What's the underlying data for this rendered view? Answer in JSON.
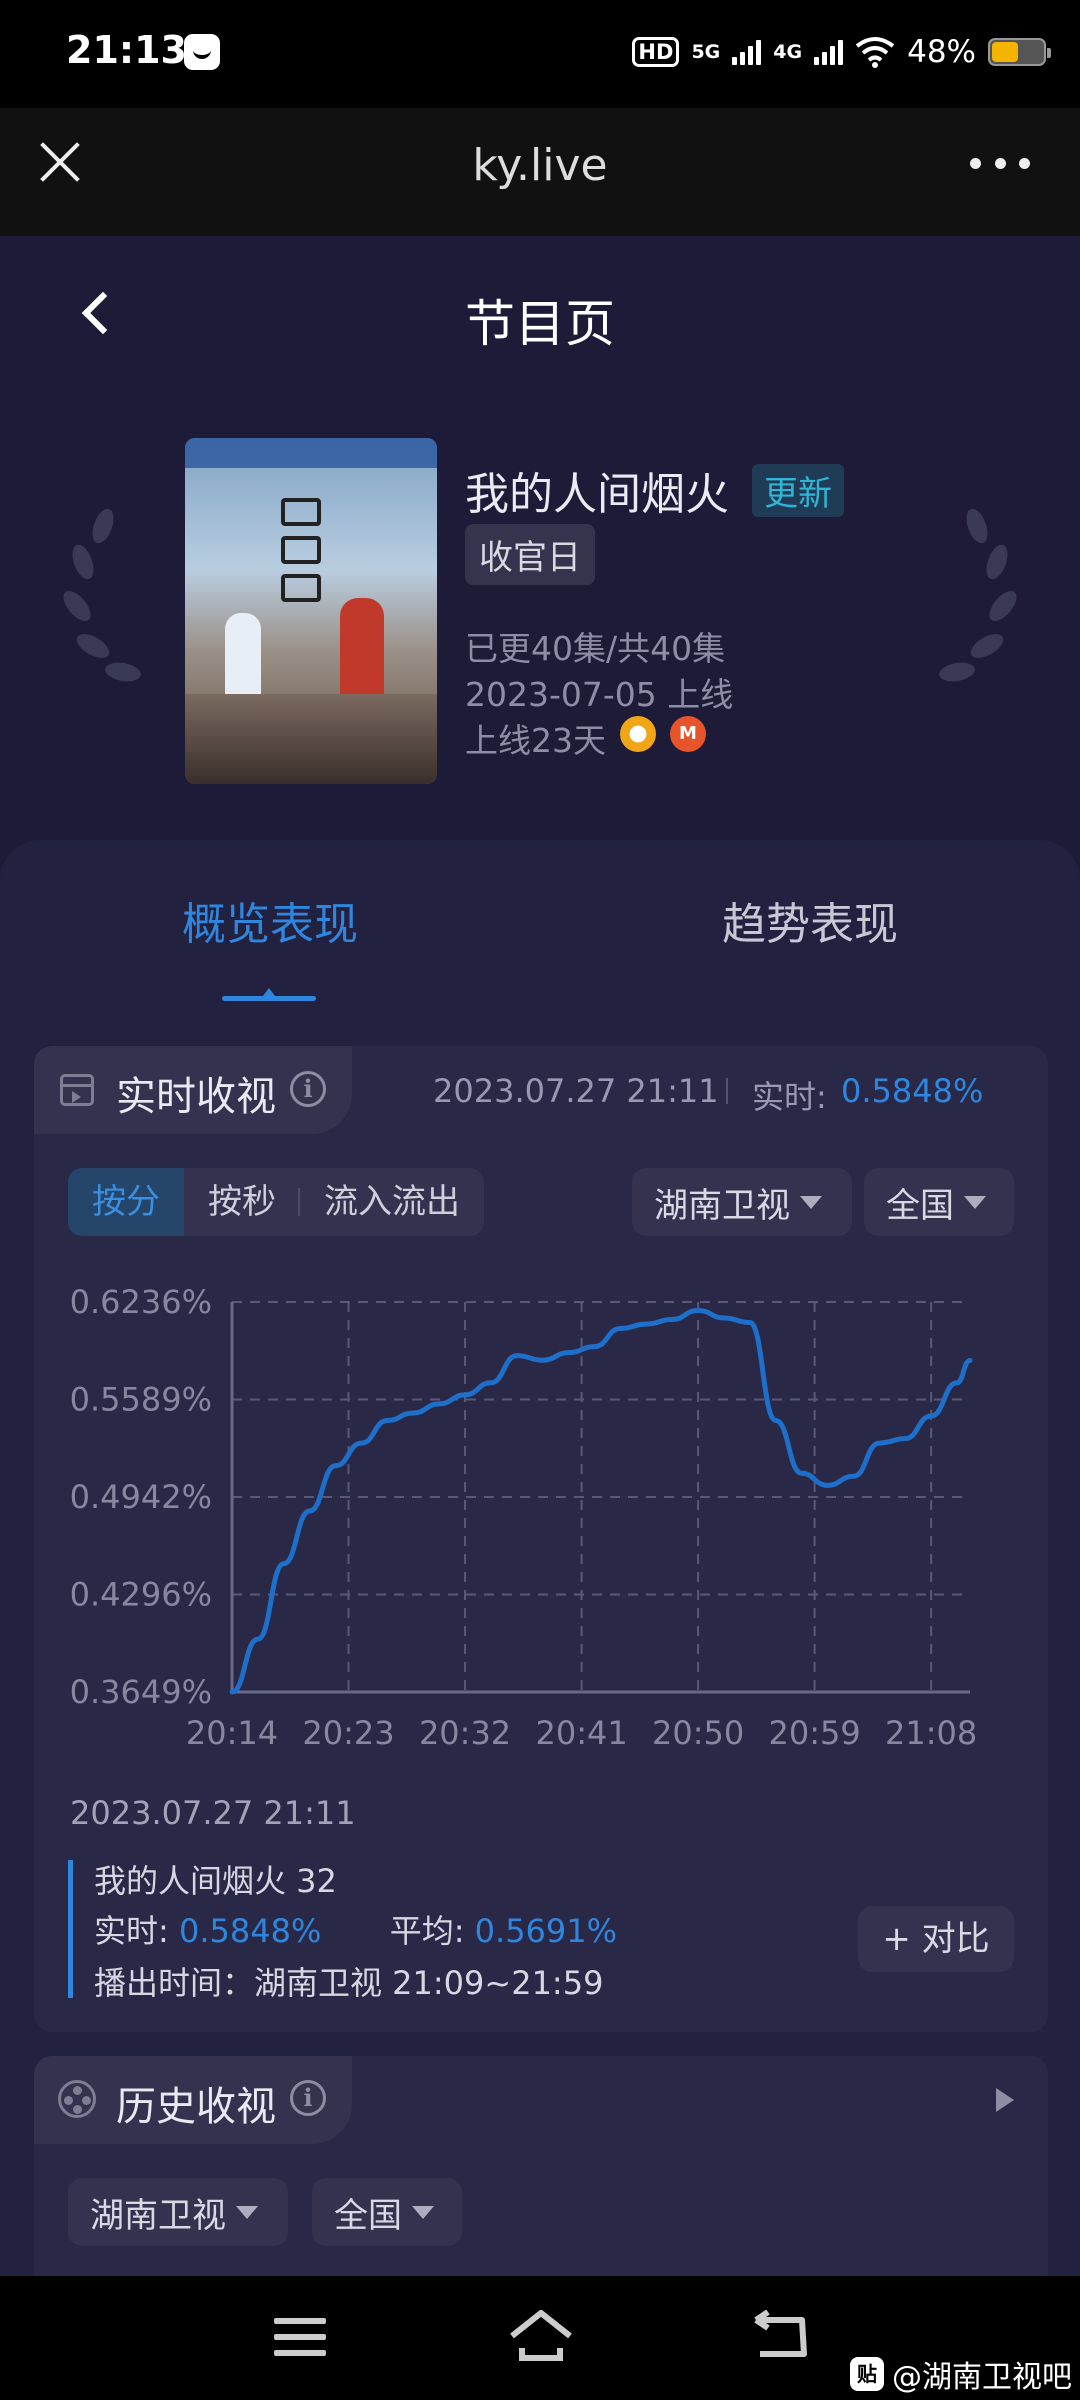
{
  "status_bar": {
    "time": "21:13",
    "hd_label": "HD",
    "net1": "5G",
    "net2": "4G",
    "battery_text": "48%",
    "battery_level": 0.48
  },
  "browser": {
    "title": "ky.live"
  },
  "page": {
    "title": "节目页"
  },
  "show": {
    "name": "我的人间烟火",
    "update_badge": "更新",
    "tag": "收官日",
    "episodes": "已更40集/共40集",
    "premiere": "2023-07-05 上线",
    "days_online": "上线23天",
    "platform_mango_label": "M"
  },
  "tabs": {
    "overview": "概览表现",
    "trend": "趋势表现"
  },
  "realtime": {
    "title": "实时收视",
    "datetime": "2023.07.27 21:11",
    "realtime_label": "实时:",
    "realtime_value": "0.5848%",
    "segments": [
      "按分",
      "按秒",
      "流入流出"
    ],
    "channel": "湖南卫视",
    "region": "全国"
  },
  "chart_data": {
    "type": "line",
    "x_ticks": [
      "20:14",
      "20:23",
      "20:32",
      "20:41",
      "20:50",
      "20:59",
      "21:08"
    ],
    "y_ticks": [
      "0.6236%",
      "0.5589%",
      "0.4942%",
      "0.4296%",
      "0.3649%"
    ],
    "ylim": [
      0.3649,
      0.6236
    ],
    "xlim_minutes": [
      "20:14",
      "21:11"
    ],
    "grid": true,
    "series": [
      {
        "color": "#1e6fc9",
        "x": [
          "20:14",
          "20:16",
          "20:18",
          "20:20",
          "20:22",
          "20:24",
          "20:26",
          "20:28",
          "20:30",
          "20:32",
          "20:34",
          "20:36",
          "20:38",
          "20:40",
          "20:42",
          "20:44",
          "20:46",
          "20:48",
          "20:50",
          "20:52",
          "20:54",
          "20:56",
          "20:58",
          "21:00",
          "21:02",
          "21:04",
          "21:06",
          "21:08",
          "21:10",
          "21:11"
        ],
        "y": [
          0.3649,
          0.4,
          0.45,
          0.485,
          0.515,
          0.53,
          0.545,
          0.55,
          0.556,
          0.562,
          0.57,
          0.588,
          0.585,
          0.59,
          0.594,
          0.606,
          0.609,
          0.612,
          0.618,
          0.613,
          0.61,
          0.545,
          0.51,
          0.502,
          0.508,
          0.53,
          0.533,
          0.548,
          0.57,
          0.5848
        ]
      }
    ]
  },
  "selection": {
    "datetime": "2023.07.27 21:11",
    "name_line": "我的人间烟火 32",
    "realtime_label": "实时:",
    "realtime_value": "0.5848%",
    "avg_label": "平均:",
    "avg_value": "0.5691%",
    "airtime": "播出时间：湖南卫视 21:09~21:59",
    "compare_button": "+ 对比"
  },
  "history": {
    "title": "历史收视",
    "channel": "湖南卫视",
    "region": "全国"
  },
  "watermark": {
    "icon_text": "贴",
    "text": "@湖南卫视吧"
  }
}
